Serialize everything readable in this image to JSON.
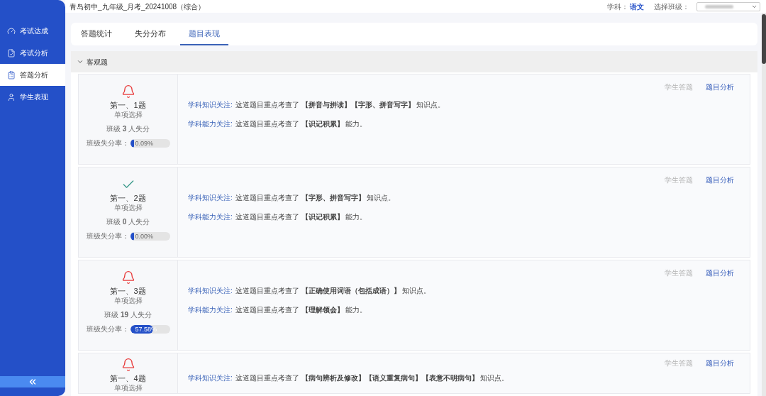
{
  "header": {
    "title": "青岛初中_九年级_月考_20241008（综合）",
    "subject_label": "学科：",
    "subject": "语文",
    "class_label": "选择班级："
  },
  "sidebar": {
    "items": [
      {
        "label": "考试达成",
        "kind": "gauge",
        "selected": false
      },
      {
        "label": "考试分析",
        "kind": "report",
        "selected": false
      },
      {
        "label": "答题分析",
        "kind": "clipboard",
        "selected": true
      },
      {
        "label": "学生表现",
        "kind": "user",
        "selected": false
      }
    ]
  },
  "tabs": [
    {
      "label": "答题统计",
      "selected": false
    },
    {
      "label": "失分分布",
      "selected": false
    },
    {
      "label": "题目表现",
      "selected": true
    }
  ],
  "section": {
    "title": "客观题",
    "expanded": true
  },
  "questions": [
    {
      "kind": "alert",
      "title": "第一、1题",
      "type": "单项选择",
      "lost": "班级 **3** 人失分",
      "rate_label": "班级失分率：",
      "rate": "0.09%",
      "level": 0.0009,
      "knowledge_label": "学科知识关注:",
      "knowledge": "这道题目重点考查了 **【拼音与拼读】【字形、拼音写字】** 知识点。",
      "ability_label": "学科能力关注:",
      "ability": "这道题目重点考查了 **【识记积累】** 能力。",
      "actions": [
        {
          "label": "学生答题",
          "disabled": true
        },
        {
          "label": "题目分析",
          "disabled": false
        }
      ]
    },
    {
      "kind": "correct",
      "title": "第一、2题",
      "type": "单项选择",
      "lost": "班级 **0** 人失分",
      "rate_label": "班级失分率：",
      "rate": "0.00%",
      "level": 0,
      "knowledge_label": "学科知识关注:",
      "knowledge": "这道题目重点考查了 **【字形、拼音写字】** 知识点。",
      "ability_label": "学科能力关注:",
      "ability": "这道题目重点考查了 **【识记积累】** 能力。",
      "actions": [
        {
          "label": "学生答题",
          "disabled": true
        },
        {
          "label": "题目分析",
          "disabled": false
        }
      ]
    },
    {
      "kind": "alert",
      "title": "第一、3题",
      "type": "单项选择",
      "lost": "班级 **19** 人失分",
      "rate_label": "班级失分率：",
      "rate": "57.58%",
      "level": 0.5758,
      "knowledge_label": "学科知识关注:",
      "knowledge": "这道题目重点考查了 **【正确使用词语（包括成语）】** 知识点。",
      "ability_label": "学科能力关注:",
      "ability": "这道题目重点考查了 **【理解领会】** 能力。",
      "actions": [
        {
          "label": "学生答题",
          "disabled": true
        },
        {
          "label": "题目分析",
          "disabled": false
        }
      ]
    },
    {
      "kind": "alert",
      "title": "第一、4题",
      "type": "单项选择",
      "knowledge_label": "学科知识关注:",
      "knowledge": "这道题目重点考查了 **【病句辨析及修改】【语义重复病句】【表意不明病句】** 知识点。",
      "actions": [
        {
          "label": "学生答题",
          "disabled": true
        },
        {
          "label": "题目分析",
          "disabled": false
        }
      ]
    }
  ]
}
